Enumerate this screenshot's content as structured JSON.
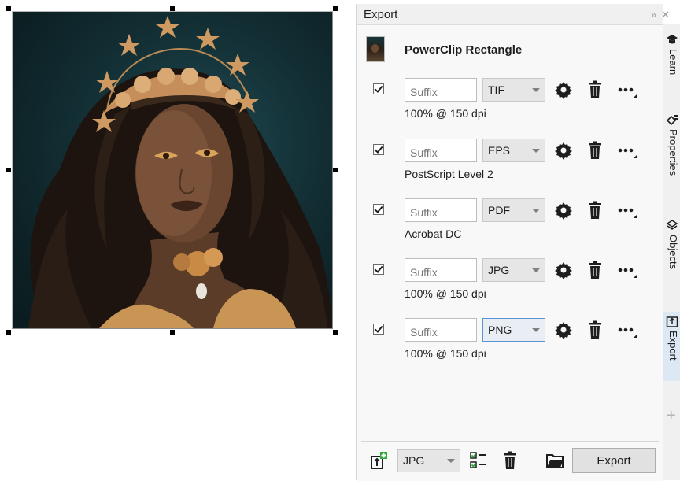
{
  "docker": {
    "title": "Export",
    "header_icons": [
      "collapse-icon",
      "close-icon"
    ],
    "object_name": "PowerClip Rectangle"
  },
  "export_rows": [
    {
      "checked": true,
      "suffix_placeholder": "Suffix",
      "format": "TIF",
      "description": "100% @ 150 dpi",
      "focused": false
    },
    {
      "checked": true,
      "suffix_placeholder": "Suffix",
      "format": "EPS",
      "description": "PostScript Level 2",
      "focused": false
    },
    {
      "checked": true,
      "suffix_placeholder": "Suffix",
      "format": "PDF",
      "description": "Acrobat DC",
      "focused": false
    },
    {
      "checked": true,
      "suffix_placeholder": "Suffix",
      "format": "JPG",
      "description": "100% @ 150 dpi",
      "focused": false
    },
    {
      "checked": true,
      "suffix_placeholder": "Suffix",
      "format": "PNG",
      "description": "100% @ 150 dpi",
      "focused": true
    }
  ],
  "bottom_bar": {
    "format": "JPG",
    "export_label": "Export"
  },
  "tabs": [
    {
      "label": "Learn",
      "icon": "graduation-cap-icon",
      "active": false
    },
    {
      "label": "Properties",
      "icon": "properties-icon",
      "active": false
    },
    {
      "label": "Objects",
      "icon": "layers-icon",
      "active": false
    },
    {
      "label": "Export",
      "icon": "export-icon",
      "active": true
    }
  ],
  "colors": {
    "accent": "#5a93d6",
    "panel_bg": "#f8f8f8",
    "canvas_bg": "#ffffff",
    "artwork_bg": "#143238"
  }
}
